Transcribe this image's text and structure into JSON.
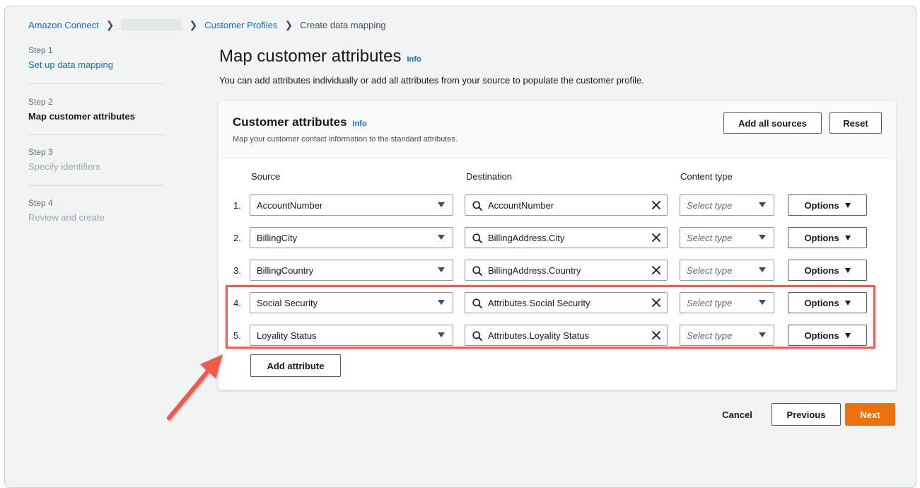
{
  "breadcrumb": {
    "home": "Amazon Connect",
    "section": "Customer Profiles",
    "current": "Create data mapping"
  },
  "steps": [
    {
      "number": "Step 1",
      "title": "Set up data mapping"
    },
    {
      "number": "Step 2",
      "title": "Map customer attributes"
    },
    {
      "number": "Step 3",
      "title": "Specify identifiers"
    },
    {
      "number": "Step 4",
      "title": "Review and create"
    }
  ],
  "page": {
    "title": "Map customer attributes",
    "info": "Info",
    "description": "You can add attributes individually or add all attributes from your source to populate the customer profile."
  },
  "card": {
    "title": "Customer attributes",
    "info": "Info",
    "description": "Map your customer contact information to the standard attributes.",
    "add_all_sources": "Add all sources",
    "reset": "Reset"
  },
  "columns": {
    "source": "Source",
    "destination": "Destination",
    "content_type": "Content type"
  },
  "rows": [
    {
      "num": "1.",
      "source": "AccountNumber",
      "destination": "AccountNumber",
      "type_placeholder": "Select type",
      "options": "Options"
    },
    {
      "num": "2.",
      "source": "BillingCity",
      "destination": "BillingAddress.City",
      "type_placeholder": "Select type",
      "options": "Options"
    },
    {
      "num": "3.",
      "source": "BillingCountry",
      "destination": "BillingAddress.Country",
      "type_placeholder": "Select type",
      "options": "Options"
    },
    {
      "num": "4.",
      "source": "Social Security",
      "destination": "Attributes.Social Security",
      "type_placeholder": "Select type",
      "options": "Options"
    },
    {
      "num": "5.",
      "source": "Loyality Status",
      "destination": "Attributes.Loyality Status",
      "type_placeholder": "Select type",
      "options": "Options"
    }
  ],
  "add_attribute": "Add attribute",
  "footer": {
    "cancel": "Cancel",
    "previous": "Previous",
    "next": "Next"
  },
  "colors": {
    "link": "#0972d3",
    "primary_button": "#ec7211",
    "highlight": "#e8605a"
  }
}
